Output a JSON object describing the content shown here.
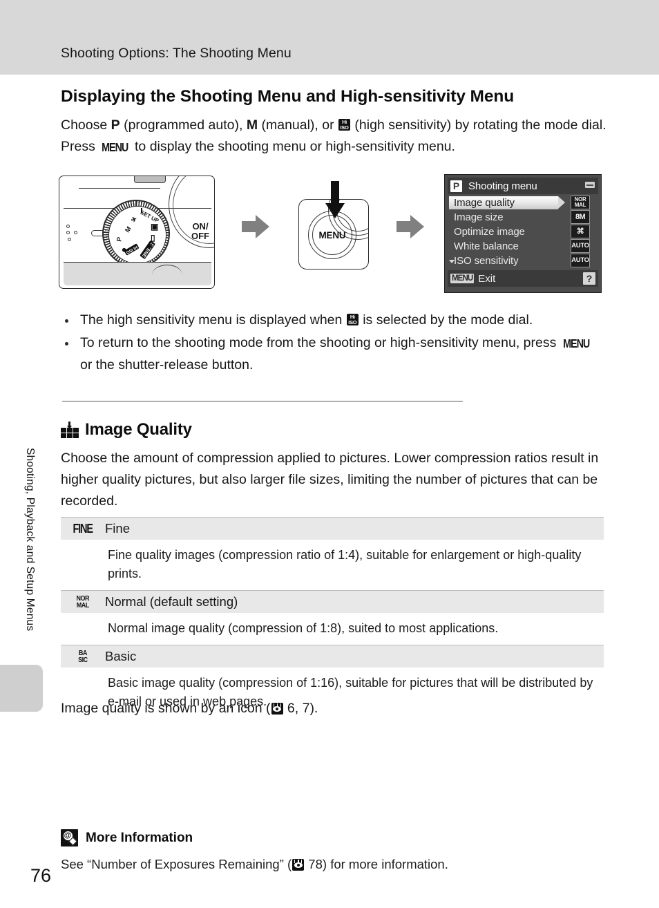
{
  "header": {
    "running_title": "Shooting Options: The Shooting Menu"
  },
  "sidebar": {
    "vertical_label": "Shooting, Playback and Setup Menus",
    "page_number": "76"
  },
  "section": {
    "title": "Displaying the Shooting Menu and High-sensitivity Menu",
    "intro_part1": "Choose ",
    "intro_mode_p": "P",
    "intro_part2": " (programmed auto), ",
    "intro_mode_m": "M",
    "intro_part3": " (manual), or ",
    "intro_part4": " (high sensitivity) by rotating the mode dial. Press ",
    "intro_menu": "MENU",
    "intro_part5": " to display the shooting menu or high-sensitivity menu.",
    "hiso_top": "Hi",
    "hiso_bottom": "ISO"
  },
  "illustration": {
    "camera": {
      "onoff_line1": "ON/",
      "onoff_line2": "OFF",
      "dial_labels": [
        "M",
        "P",
        "SET UP",
        "SCENE"
      ],
      "dial_chip_iso": "HI ISO"
    },
    "menu_button": {
      "label": "MENU"
    },
    "arrow_name": "process-arrow"
  },
  "lcd": {
    "mode_badge": "P",
    "title": "Shooting menu",
    "rows": [
      {
        "label": "Image quality",
        "icon_top": "NOR",
        "icon_bottom": "MAL",
        "selected": true
      },
      {
        "label": "Image size",
        "icon_top": "8M",
        "icon_bottom": "",
        "selected": false
      },
      {
        "label": "Optimize image",
        "icon_top": "OPT",
        "icon_bottom": "",
        "selected": false
      },
      {
        "label": "White balance",
        "icon_top": "AUTO",
        "icon_bottom": "",
        "selected": false
      },
      {
        "label": "ISO sensitivity",
        "icon_top": "AUTO",
        "icon_bottom": "",
        "selected": false
      }
    ],
    "footer_menu": "MENU",
    "footer_exit": "Exit",
    "footer_help": "?"
  },
  "bullets": {
    "item1_part1": "The high sensitivity menu is displayed when ",
    "item1_part2": " is selected by the mode dial.",
    "item2_part1": "To return to the shooting mode from the shooting or high-sensitivity menu, press ",
    "item2_menu": "MENU",
    "item2_part2": " or the shutter-release button."
  },
  "image_quality": {
    "heading": "Image Quality",
    "paragraph": "Choose the amount of compression applied to pictures. Lower compression ratios result in higher quality pictures, but also larger file sizes, limiting the number of pictures that can be recorded.",
    "rows": [
      {
        "glyph": "FINE",
        "glyph_style": "single",
        "label": "Fine",
        "description": "Fine quality images (compression ratio of 1:4), suitable for enlargement or high-quality prints."
      },
      {
        "glyph_top": "NOR",
        "glyph_bottom": "MAL",
        "glyph_style": "stacked",
        "label": "Normal (default setting)",
        "description": "Normal image quality (compression of 1:8), suited to most applications."
      },
      {
        "glyph_top": "BA",
        "glyph_bottom": "SIC",
        "glyph_style": "stacked",
        "label": "Basic",
        "description": "Basic image quality (compression of 1:16), suitable for pictures that will be distributed by e-mail or used in web pages."
      }
    ],
    "closing_part1": "Image quality is shown by an icon (",
    "closing_ref": " 6, 7).",
    "closing_part2": ""
  },
  "more_information": {
    "title": "More Information",
    "text_part1": "See “Number of Exposures Remaining” (",
    "text_ref": " 78) for more information.",
    "text_part2": ""
  }
}
